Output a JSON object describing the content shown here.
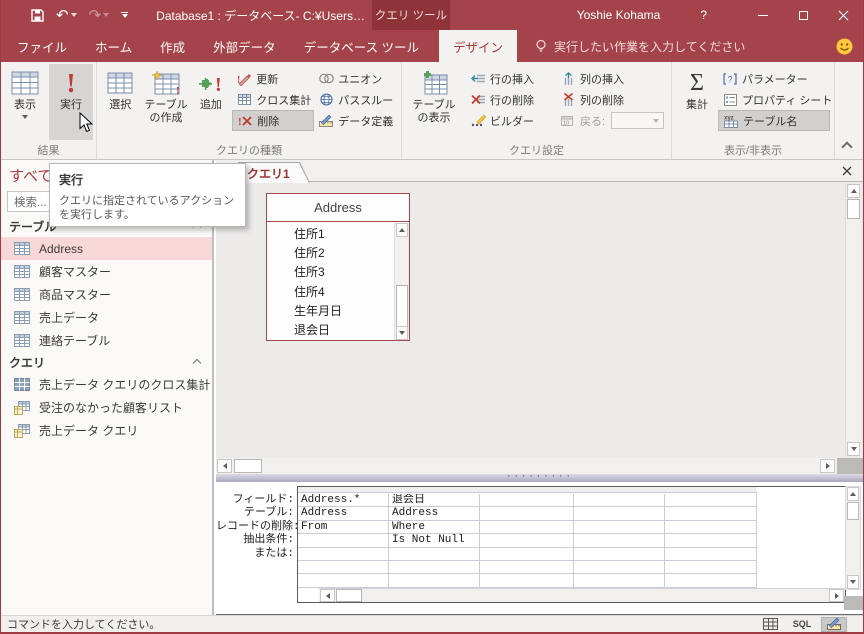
{
  "titlebar": {
    "title": "Database1 : データベース- C:¥Users…",
    "contextual": "クエリ ツール",
    "user": "Yoshie Kohama",
    "help": "?"
  },
  "tabs": {
    "file": "ファイル",
    "home": "ホーム",
    "create": "作成",
    "external": "外部データ",
    "dbtools": "データベース ツール",
    "design": "デザイン"
  },
  "tellme": "実行したい作業を入力してください",
  "ribbon": {
    "groups": {
      "results": "結果",
      "query_type": "クエリの種類",
      "query_setup": "クエリ設定",
      "show_hide": "表示/非表示"
    },
    "btn": {
      "view": "表示",
      "run": "実行",
      "select": "選択",
      "make_table": "テーブルの作成",
      "append": "追加",
      "update": "更新",
      "crosstab": "クロス集計",
      "delete": "削除",
      "union": "ユニオン",
      "pass_through": "パススルー",
      "data_definition": "データ定義",
      "show_table": "テーブルの表示",
      "insert_rows": "行の挿入",
      "delete_rows": "行の削除",
      "builder": "ビルダー",
      "insert_columns": "列の挿入",
      "delete_columns": "列の削除",
      "return": "戻る:",
      "totals": "集計",
      "parameters": "パラメーター",
      "property_sheet": "プロパティ シート",
      "table_names": "テーブル名"
    }
  },
  "tooltip": {
    "title": "実行",
    "body": "クエリに指定されているアクションを実行します。"
  },
  "nav": {
    "title": "すべての Access オブジェクト",
    "search": "検索...",
    "group_tables": "テーブル",
    "group_queries": "クエリ",
    "tables": [
      "Address",
      "顧客マスター",
      "商品マスター",
      "売上データ",
      "連絡テーブル"
    ],
    "queries": [
      "売上データ クエリのクロス集計",
      "受注のなかった顧客リスト",
      "売上データ クエリ"
    ]
  },
  "doc": {
    "tab": "クエリ1"
  },
  "field_list": {
    "title": "Address",
    "fields": [
      "住所1",
      "住所2",
      "住所3",
      "住所4",
      "生年月日",
      "退会日"
    ]
  },
  "grid": {
    "labels": [
      "フィールド:",
      "テーブル:",
      "レコードの削除:",
      "抽出条件:",
      "または:"
    ],
    "col1": [
      "Address.*",
      "Address",
      "From",
      "",
      ""
    ],
    "col2": [
      "退会日",
      "Address",
      "Where",
      "Is Not Null",
      ""
    ]
  },
  "status": {
    "message": "コマンドを入力してください。",
    "sql": "SQL"
  }
}
